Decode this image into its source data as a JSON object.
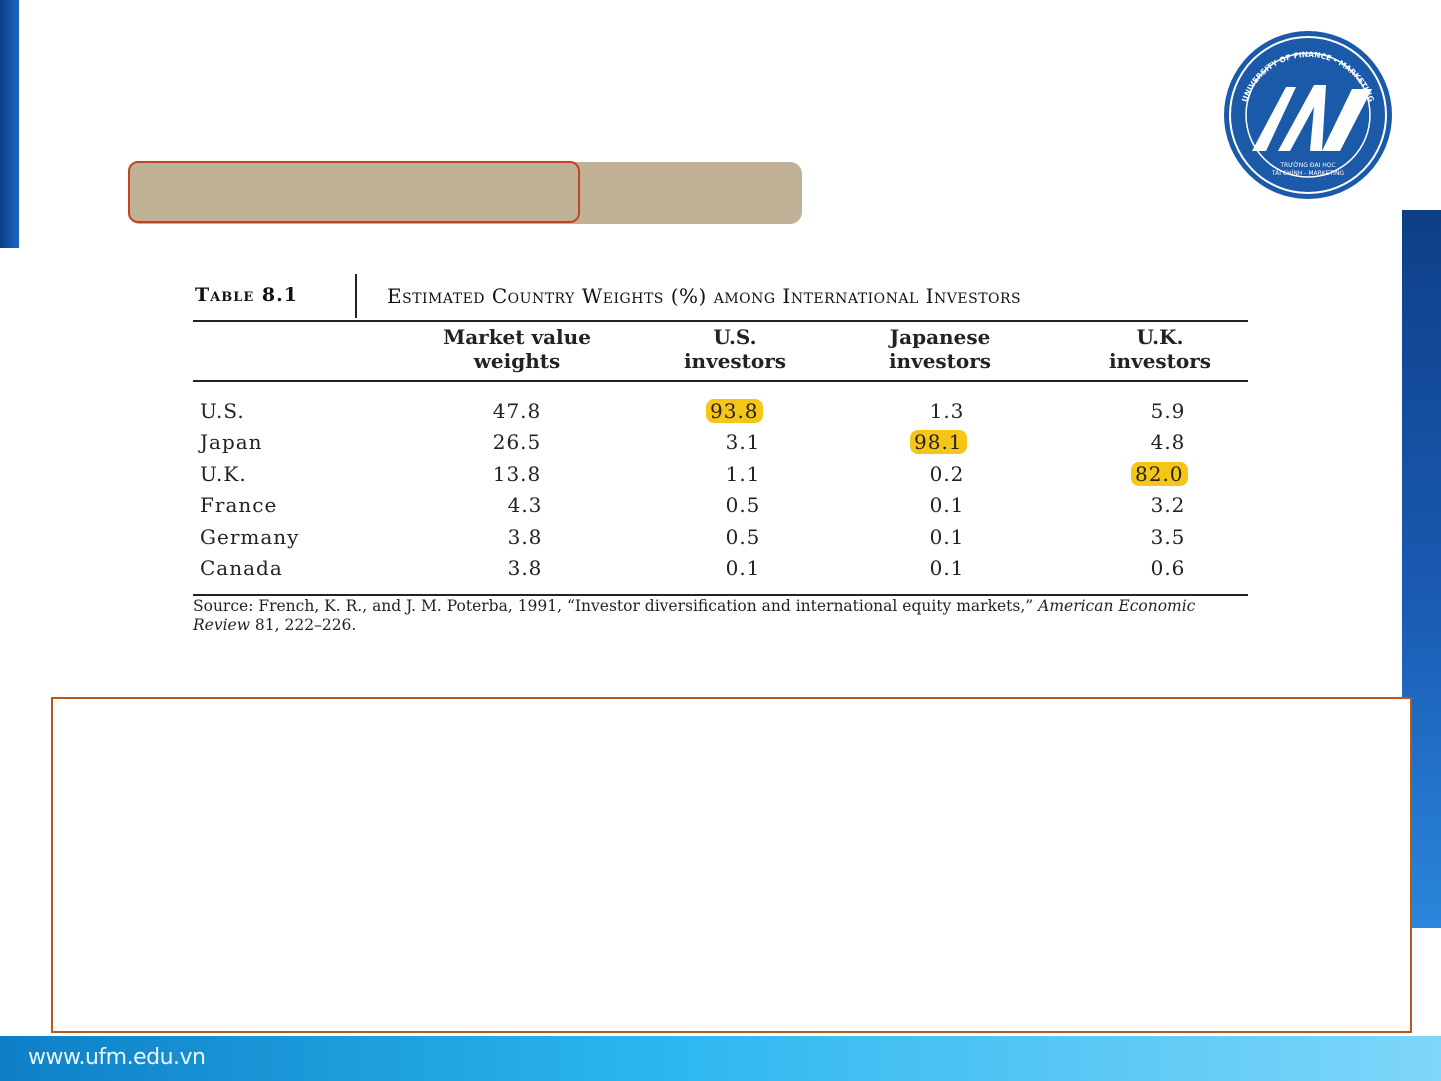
{
  "logo": {
    "arc_text": "UNIVERSITY OF FINANCE - MARKETING",
    "line1": "TRƯỜNG ĐẠI HỌC",
    "line2": "TÀI CHÍNH - MARKETING"
  },
  "table": {
    "label": "Table 8.1",
    "title": "Estimated Country Weights (%) among International Investors",
    "headers": [
      {
        "line1": "Market value",
        "line2": "weights"
      },
      {
        "line1": "U.S.",
        "line2": "investors"
      },
      {
        "line1": "Japanese",
        "line2": "investors"
      },
      {
        "line1": "U.K.",
        "line2": "investors"
      }
    ],
    "rows": [
      {
        "country": "U.S.",
        "values": [
          "47.8",
          "93.8",
          "1.3",
          "5.9"
        ]
      },
      {
        "country": "Japan",
        "values": [
          "26.5",
          "3.1",
          "98.1",
          "4.8"
        ]
      },
      {
        "country": "U.K.",
        "values": [
          "13.8",
          "1.1",
          "0.2",
          "82.0"
        ]
      },
      {
        "country": "France",
        "values": [
          "4.3",
          "0.5",
          "0.1",
          "3.2"
        ]
      },
      {
        "country": "Germany",
        "values": [
          "3.8",
          "0.5",
          "0.1",
          "3.5"
        ]
      },
      {
        "country": "Canada",
        "values": [
          "3.8",
          "0.1",
          "0.1",
          "0.6"
        ]
      }
    ],
    "source_prefix": "Source: French, K. R., and J. M. Poterba, 1991, “Investor diversification and international equity markets,” ",
    "source_journal": "American Economic Review",
    "source_suffix": " 81, 222–226."
  },
  "highlight_color": "#f5c518",
  "footer": {
    "url": "www.ufm.edu.vn"
  }
}
